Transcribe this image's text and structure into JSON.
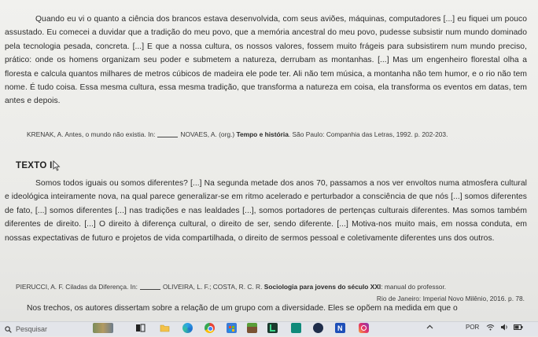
{
  "paragraph1": "Quando eu vi o quanto a ciência dos brancos estava desenvolvida, com seus aviões, máquinas, computadores [...] eu fiquei um pouco assustado. Eu comecei a duvidar que a tradição do meu povo, que a memória ancestral do meu povo, pudesse subsistir num mundo dominado pela tecnologia pesada, concreta. [...] E que a nossa cultura, os nossos valores, fossem muito frágeis para subsistirem num mundo preciso, prático: onde os homens organizam seu poder e submetem a natureza, derrubam as montanhas. [...] Mas um engenheiro florestal olha a floresta e calcula quantos milhares de metros cúbicos de madeira ele pode ter. Ali não tem música, a montanha não tem humor, e o rio não tem nome. É tudo coisa. Essa mesma cultura, essa mesma tradição, que transforma a natureza em coisa, ela transforma os eventos em datas, tem antes e depois.",
  "citation1": {
    "before": "KRENAK, A. Antes, o mundo não existia. In:",
    "after": "NOVAES, A. (org.)",
    "bold": "Tempo e história",
    "rest": ". São Paulo: Companhia das Letras, 1992. p. 202-203."
  },
  "heading2": "TEXTO II",
  "paragraph2": "Somos todos iguais ou somos diferentes? [...] Na segunda metade dos anos 70, passamos a nos ver envoltos numa atmosfera cultural e ideológica inteiramente nova, na qual parece generalizar-se em ritmo acelerado e perturbador a consciência de que nós [...] somos diferentes de fato, [...] somos diferentes [...] nas tradições e nas lealdades [...], somos portadores de pertenças culturais diferentes. Mas somos também diferentes de direito. [...] O direito à diferença cultural, o direito de ser, sendo diferente. [...] Motiva-nos muito mais, em nossa conduta, em nossas expectativas de futuro e projetos de vida compartilhada, o direito de sermos pessoal e coletivamente diferentes uns dos outros.",
  "citation2": {
    "before": "PIERUCCI, A. F. Ciladas da Diferença. In:",
    "after": "OLIVEIRA, L. F.; COSTA, R. C. R.",
    "bold": "Sociologia para jovens do século XXI",
    "rest": ": manual do professor.",
    "line2": "Rio de Janeiro: Imperial Novo Milênio, 2016. p. 78."
  },
  "final_line": "Nos trechos, os autores dissertam sobre a relação de um grupo com a diversidade. Eles se opõem na medida em que o",
  "taskbar": {
    "search_placeholder": "Pesquisar",
    "language": "POR",
    "icons": [
      "search-icon",
      "weather-thumbnail",
      "task-view-icon",
      "file-explorer-icon",
      "edge-icon",
      "chrome-icon",
      "store-icon",
      "minecraft-icon",
      "l-app-icon",
      "wifi-app-icon",
      "dark-app-icon",
      "instagram-icon",
      "chevron-up-icon",
      "wifi-icon",
      "volume-icon",
      "battery-icon"
    ],
    "colors": {
      "taskbar_bg": "#e3e5ea",
      "page_bg": "#f1f1ee"
    }
  }
}
